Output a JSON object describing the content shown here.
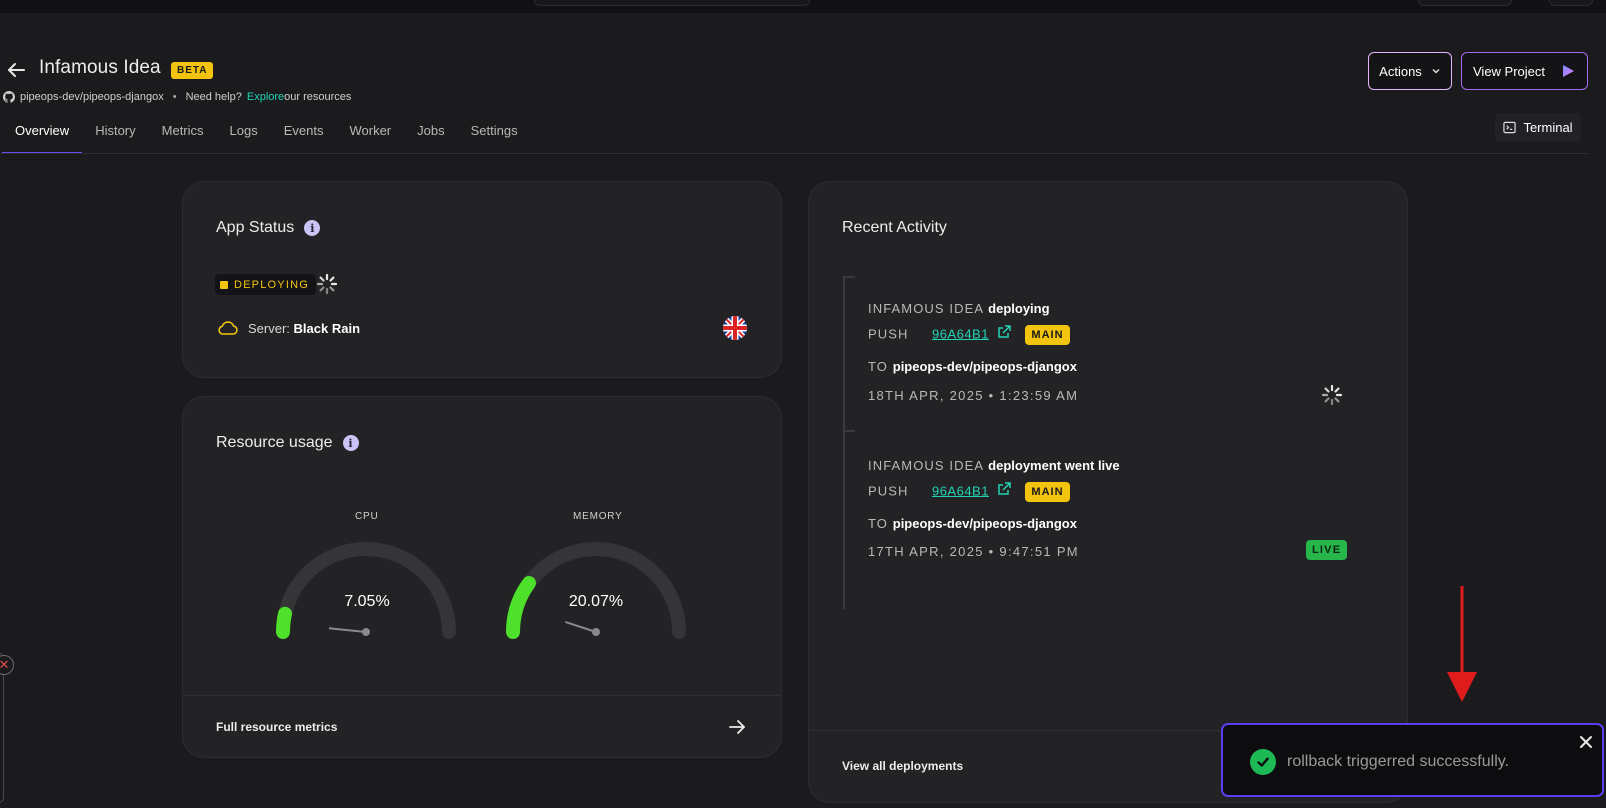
{
  "header": {
    "title": "Infamous Idea",
    "badge": "BETA",
    "repo": "pipeops-dev/pipeops-djangox",
    "separator": "•",
    "help_prefix": "Need help?",
    "help_link": "Explore",
    "help_suffix": "our resources"
  },
  "buttons": {
    "actions_label": "Actions",
    "view_project_label": "View Project",
    "terminal_label": "Terminal"
  },
  "tabs": [
    {
      "label": "Overview",
      "active": true
    },
    {
      "label": "History"
    },
    {
      "label": "Metrics"
    },
    {
      "label": "Logs"
    },
    {
      "label": "Events"
    },
    {
      "label": "Worker"
    },
    {
      "label": "Jobs"
    },
    {
      "label": "Settings"
    }
  ],
  "app_status": {
    "title": "App Status",
    "status": "DEPLOYING",
    "server_label": "Server:",
    "server_name": "Black Rain",
    "region_icon": "uk-flag-icon"
  },
  "resource_usage": {
    "title": "Resource usage",
    "cpu": {
      "label": "CPU",
      "value": "7.05%",
      "percent": 7.05
    },
    "memory": {
      "label": "MEMORY",
      "value": "20.07%",
      "percent": 20.07
    },
    "footer_link": "Full resource metrics"
  },
  "recent_activity": {
    "title": "Recent Activity",
    "items": [
      {
        "app": "INFAMOUS IDEA",
        "event": "deploying",
        "push_label": "PUSH",
        "commit": "96A64B1",
        "branch": "MAIN",
        "to_label": "TO",
        "repo": "pipeops-dev/pipeops-djangox",
        "time": "18TH APR, 2025 • 1:23:59 AM",
        "state_icon": "spinner-icon"
      },
      {
        "app": "INFAMOUS IDEA",
        "event": "deployment went live",
        "push_label": "PUSH",
        "commit": "96A64B1",
        "branch": "MAIN",
        "to_label": "TO",
        "repo": "pipeops-dev/pipeops-djangox",
        "time": "17TH APR, 2025 • 9:47:51 PM",
        "state": "LIVE"
      }
    ],
    "footer_link": "View all deployments"
  },
  "toast": {
    "message": "rollback triggerred successfully."
  },
  "colors": {
    "accent_yellow": "#f2c40f",
    "link_teal": "#22d3b4",
    "gauge_green": "#4ee02a",
    "tab_underline": "#6b4cf0",
    "toast_border": "#5b3ef0",
    "live_green": "#27b64a",
    "annotation_arrow": "#e01b1b"
  }
}
